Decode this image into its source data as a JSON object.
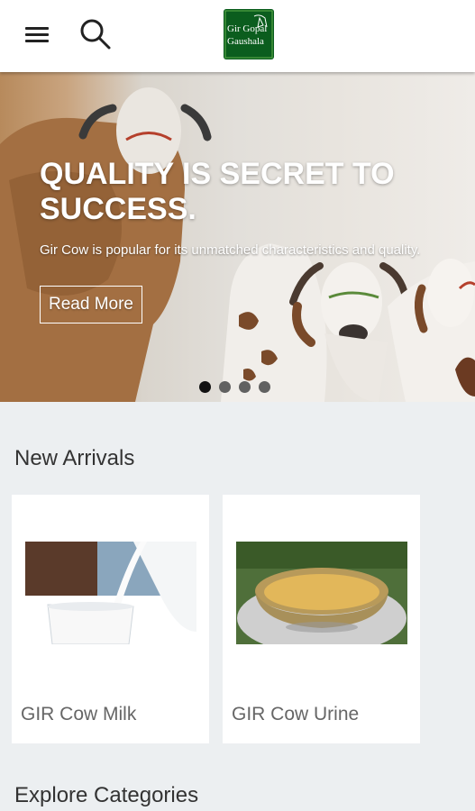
{
  "header": {
    "menu_icon": "hamburger-menu-icon",
    "search_icon": "search-icon",
    "logo_text_line1": "Gir Gopal",
    "logo_text_line2": "Gaushala"
  },
  "hero": {
    "title": "QUALITY IS SECRET TO SUCCESS.",
    "description": "Gir Cow is popular for its unmatched characteristics and quality.",
    "button_label": "Read More",
    "slide_count": 4,
    "active_slide": 1
  },
  "new_arrivals": {
    "title": "New Arrivals",
    "products": [
      {
        "name": "GIR Cow Milk"
      },
      {
        "name": "GIR Cow Urine"
      }
    ]
  },
  "explore": {
    "title": "Explore Categories"
  },
  "colors": {
    "header_bg": "#ffffff",
    "page_bg": "#eceff1",
    "logo_bg": "#0b5d1e",
    "active_dot": "#111111",
    "inactive_dot": "#616161"
  }
}
